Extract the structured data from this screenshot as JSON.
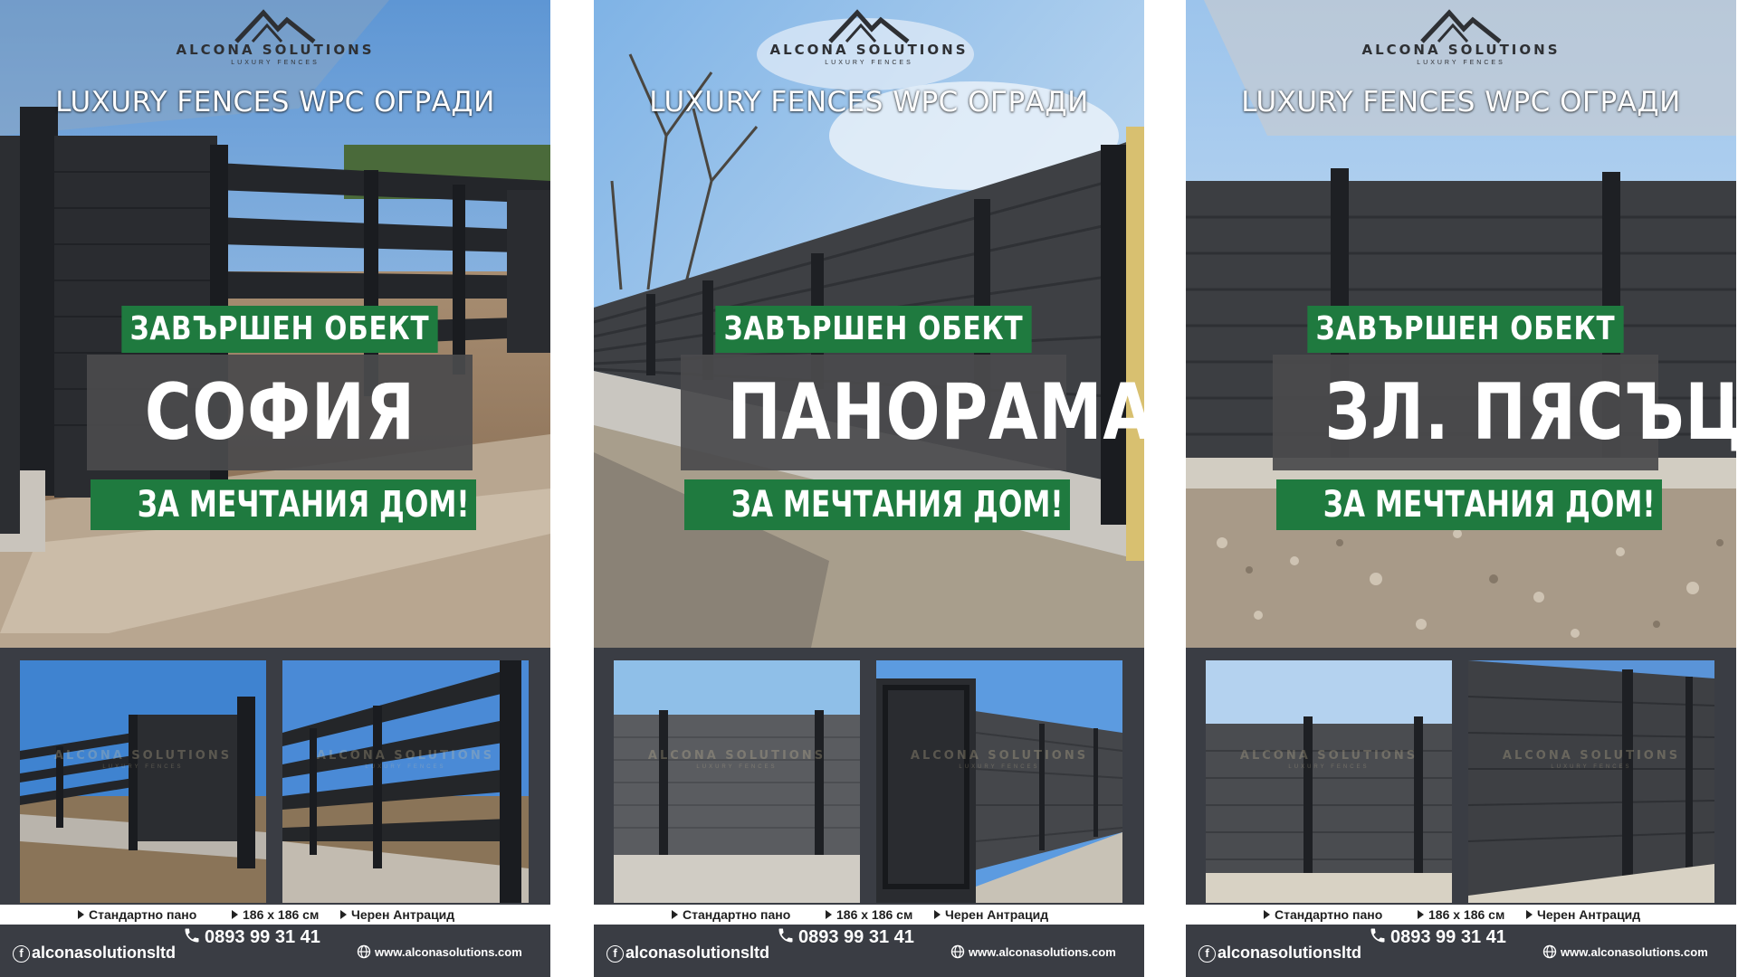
{
  "posters": [
    {
      "brand": "ALCONA SOLUTIONS",
      "brand_tagline": "LUXURY FENCES",
      "headline": "LUXURY FENCES WPC ОГРАДИ",
      "banner_top": "ЗАВЪРШЕН ОБЕКТ",
      "city": "СОФИЯ",
      "banner_bottom": "ЗА МЕЧТАНИЯ ДОМ!",
      "watermark_brand": "ALCONA SOLUTIONS",
      "watermark_tagline": "LUXURY FENCES",
      "specs": [
        "Стандартно пано",
        "186 x 186 см",
        "Черен Антрацид"
      ],
      "social": "alconasolutionsltd",
      "phone": "0893 99 31 41",
      "website": "www.alconasolutions.com"
    },
    {
      "brand": "ALCONA SOLUTIONS",
      "brand_tagline": "LUXURY FENCES",
      "headline": "LUXURY FENCES WPC ОГРАДИ",
      "banner_top": "ЗАВЪРШЕН ОБЕКТ",
      "city": "ПАНОРАМА",
      "banner_bottom": "ЗА МЕЧТАНИЯ ДОМ!",
      "watermark_brand": "ALCONA SOLUTIONS",
      "watermark_tagline": "LUXURY FENCES",
      "specs": [
        "Стандартно пано",
        "186 x 186 см",
        "Черен Антрацид"
      ],
      "social": "alconasolutionsltd",
      "phone": "0893 99 31 41",
      "website": "www.alconasolutions.com"
    },
    {
      "brand": "ALCONA SOLUTIONS",
      "brand_tagline": "LUXURY FENCES",
      "headline": "LUXURY FENCES WPC ОГРАДИ",
      "banner_top": "ЗАВЪРШЕН ОБЕКТ",
      "city": "ЗЛ. ПЯСЪЦИ",
      "banner_bottom": "ЗА МЕЧТАНИЯ ДОМ!",
      "watermark_brand": "ALCONA SOLUTIONS",
      "watermark_tagline": "LUXURY FENCES",
      "specs": [
        "Стандартно пано",
        "186 x 186 см",
        "Черен Антрацид"
      ],
      "social": "alconasolutionsltd",
      "phone": "0893 99 31 41",
      "website": "www.alconasolutions.com"
    }
  ],
  "colors": {
    "banner_green": "#1f7a3f",
    "city_panel": "#4a4a4c",
    "footer_bg": "#3a3d44",
    "fence_anthracite": "#2a2c30"
  },
  "icons": [
    "logo-mountains-icon",
    "facebook-icon",
    "phone-icon",
    "globe-icon",
    "spec-triangle-icon"
  ]
}
